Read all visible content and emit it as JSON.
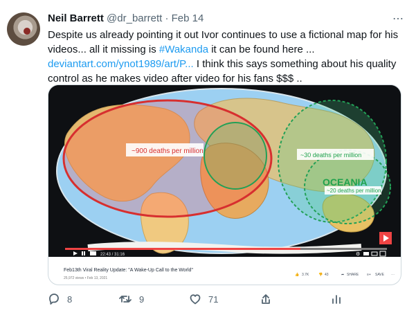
{
  "tweet": {
    "name": "Neil Barrett",
    "handle": "@dr_barrett",
    "dot": "·",
    "date": "Feb 14",
    "text_part1": "Despite us already pointing it out Ivor continues to use a fictional map for his videos... all it missing is ",
    "hashtag": "#Wakanda",
    "text_part2": " it can be found here ...",
    "link": "deviantart.com/ynot1989/art/P...",
    "text_part3": " I think this says something about his quality control as he makes video after video for his fans $$$ .."
  },
  "media": {
    "title": "Feb13th Viral Reality Update: \"A Wake-Up Call to the World\"",
    "views": "25,972 views • Feb 13, 2021",
    "likes": "3.7K",
    "dislikes": "43",
    "share": "SHARE",
    "save": "SAVE",
    "time": "22:43 / 31:16",
    "map_labels": {
      "left": "~900 deaths per million",
      "right_top": "~30 deaths per million",
      "oceania": "OCEANIA",
      "oceania_sub": "~20 deaths per million"
    }
  },
  "actions": {
    "reply_count": "8",
    "retweet_count": "9",
    "like_count": "71"
  },
  "colors": {
    "link": "#1d9bf0",
    "red_circle": "#d72f2f",
    "green_circle": "#22a056"
  }
}
